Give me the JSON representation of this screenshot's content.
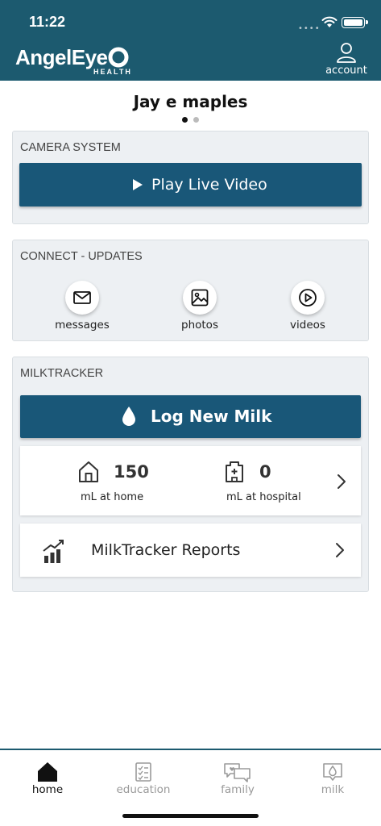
{
  "status_bar": {
    "time": "11:22",
    "signal_dots": "••••"
  },
  "header": {
    "logo_text": "AngelEye",
    "logo_subtext": "HEALTH",
    "account_label": "account",
    "colors": {
      "header_bg": "#1c5a6f",
      "primary_button": "#195778"
    }
  },
  "patient": {
    "name": "Jay e maples",
    "pager": {
      "count": 2,
      "active_index": 0
    }
  },
  "camera_system": {
    "title": "CAMERA SYSTEM",
    "play_label": "Play Live Video",
    "icon": "play-icon"
  },
  "connect_updates": {
    "title": "CONNECT - UPDATES",
    "items": [
      {
        "label": "messages",
        "icon": "envelope-icon"
      },
      {
        "label": "photos",
        "icon": "image-icon"
      },
      {
        "label": "videos",
        "icon": "play-circle-icon"
      }
    ]
  },
  "milktracker": {
    "title": "MILKTRACKER",
    "log_label": "Log New Milk",
    "home": {
      "value": "150",
      "label": "mL at home",
      "icon": "house-icon"
    },
    "hospital": {
      "value": "0",
      "label": "mL at hospital",
      "icon": "hospital-icon"
    },
    "reports_label": "MilkTracker Reports"
  },
  "tabbar": {
    "tabs": [
      {
        "label": "home",
        "icon": "home-icon",
        "active": true
      },
      {
        "label": "education",
        "icon": "checklist-icon",
        "active": false
      },
      {
        "label": "family",
        "icon": "chat-bubbles-icon",
        "active": false
      },
      {
        "label": "milk",
        "icon": "milk-drop-icon",
        "active": false
      }
    ]
  }
}
